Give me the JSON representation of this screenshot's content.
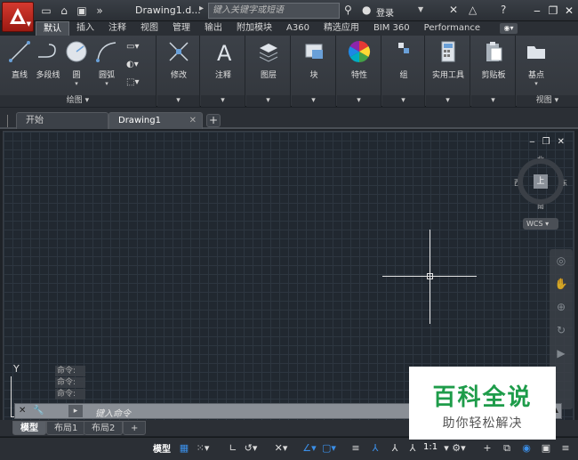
{
  "titlebar": {
    "doc_title": "Drawing1.d...",
    "search_placeholder": "键入关键字或短语",
    "login": "登录"
  },
  "ribbon_tabs": [
    "默认",
    "插入",
    "注释",
    "视图",
    "管理",
    "输出",
    "附加模块",
    "A360",
    "精选应用",
    "BIM 360",
    "Performance"
  ],
  "ribbon": {
    "draw_panel": {
      "line": "直线",
      "polyline": "多段线",
      "circle": "圆",
      "arc": "圆弧",
      "footer": "绘图 ▾"
    },
    "modify": "修改",
    "annotation": "注释",
    "layers": "图层",
    "block": "块",
    "properties": "特性",
    "groups": "组",
    "utilities": "实用工具",
    "clipboard": "剪贴板",
    "base": "基点",
    "view_footer": "视图 ▾"
  },
  "doc_tabs": {
    "start": "开始",
    "drawing": "Drawing1"
  },
  "viewcube": {
    "top": "上",
    "north": "北",
    "south": "南",
    "east": "东",
    "west": "西",
    "wcs": "WCS"
  },
  "ucs_y": "Y",
  "command": {
    "history": [
      "命令:",
      "命令:",
      "命令:"
    ],
    "input_placeholder": "键入命令"
  },
  "layout_tabs": [
    "模型",
    "布局1",
    "布局2"
  ],
  "statusbar": {
    "model": "模型",
    "scale": "1:1"
  },
  "watermark": {
    "title": "百科全说",
    "subtitle": "助你轻松解决"
  }
}
